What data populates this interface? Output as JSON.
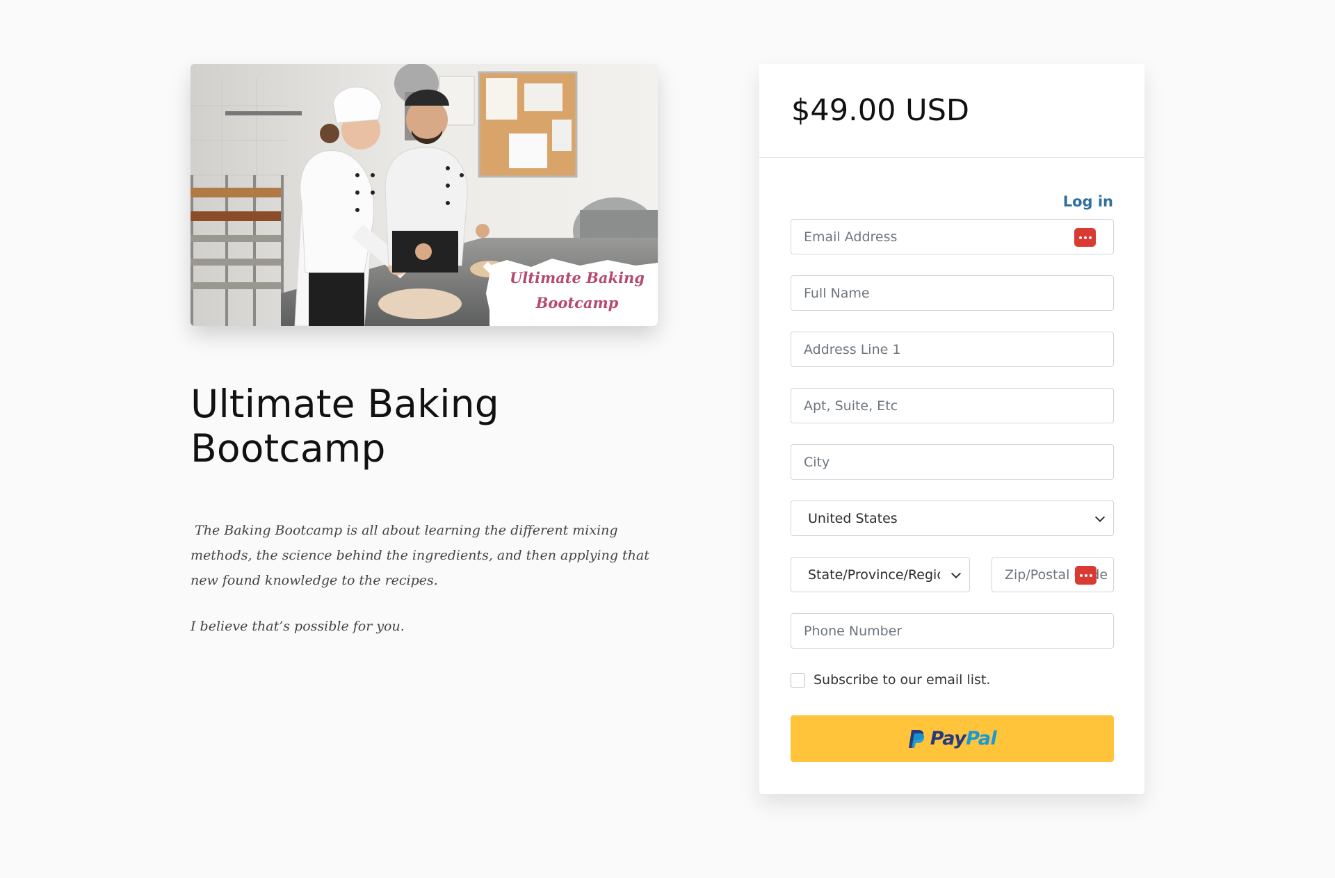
{
  "product": {
    "image_caption_line1": "Ultimate Baking",
    "image_caption_line2": "Bootcamp",
    "title": "Ultimate Baking Bootcamp",
    "description_p1": " The Baking Bootcamp is all about learning the different mixing methods, the science behind the ingredients, and then applying that new found knowledge to the recipes.",
    "description_p2": "I believe that’s possible for you."
  },
  "checkout": {
    "price": "$49.00 USD",
    "login_label": "Log in",
    "fields": {
      "email": "Email Address",
      "full_name": "Full Name",
      "address1": "Address Line 1",
      "address2": "Apt, Suite, Etc",
      "city": "City",
      "country": "United States",
      "state": "State/Province/Regio",
      "zip": "Zip/Postal Code",
      "phone": "Phone Number"
    },
    "subscribe_label": "Subscribe to our email list.",
    "paypal_word1": "Pay",
    "paypal_word2": "Pal"
  },
  "colors": {
    "accent_link": "#2f6f9f",
    "paypal_yellow": "#ffc439",
    "password_manager_red": "#d93a31",
    "caption_pink": "#b5496e"
  },
  "icons": [
    "password-manager-icon",
    "chevron-down-icon",
    "paypal-logo-icon"
  ]
}
